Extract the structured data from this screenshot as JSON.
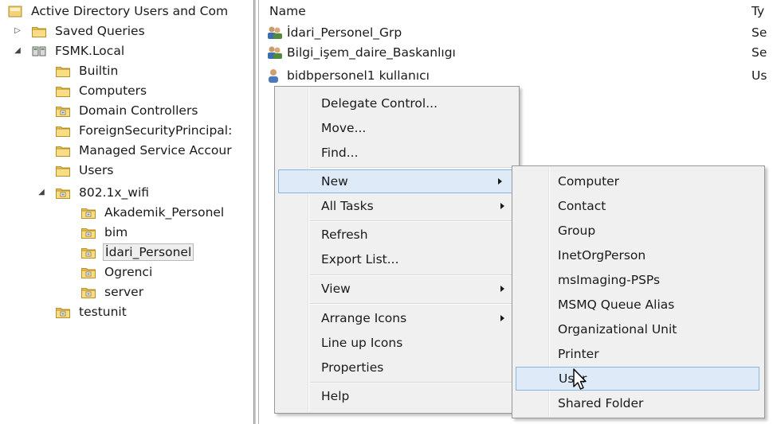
{
  "tree": {
    "root_label": "Active Directory Users and Com",
    "items": [
      {
        "label": "Saved Queries"
      },
      {
        "label": "FSMK.Local"
      },
      {
        "label": "Builtin"
      },
      {
        "label": "Computers"
      },
      {
        "label": "Domain Controllers"
      },
      {
        "label": "ForeignSecurityPrincipal:"
      },
      {
        "label": "Managed Service Accour"
      },
      {
        "label": "Users"
      },
      {
        "label": "802.1x_wifi"
      },
      {
        "label": "Akademik_Personel"
      },
      {
        "label": "bim"
      },
      {
        "label": "İdari_Personel"
      },
      {
        "label": "Ogrenci"
      },
      {
        "label": "server"
      },
      {
        "label": "testunit"
      }
    ]
  },
  "list": {
    "columns": {
      "name": "Name",
      "type": "Ty"
    },
    "rows": [
      {
        "name": "İdari_Personel_Grp",
        "type": "Se",
        "icon": "group-icon"
      },
      {
        "name": "Bilgi_işem_daire_Baskanlıgı",
        "type": "Se",
        "icon": "group-icon"
      },
      {
        "name": "bidbpersonel1 kullanıcı",
        "type": "Us",
        "icon": "user-icon"
      }
    ]
  },
  "context_menu": {
    "items": [
      {
        "label": "Delegate Control..."
      },
      {
        "label": "Move..."
      },
      {
        "label": "Find..."
      },
      {
        "label": "New",
        "submenu": true,
        "highlighted": true
      },
      {
        "label": "All Tasks",
        "submenu": true
      },
      {
        "label": "Refresh"
      },
      {
        "label": "Export List..."
      },
      {
        "label": "View",
        "submenu": true
      },
      {
        "label": "Arrange Icons",
        "submenu": true
      },
      {
        "label": "Line up Icons"
      },
      {
        "label": "Properties"
      },
      {
        "label": "Help"
      }
    ]
  },
  "new_submenu": {
    "items": [
      {
        "label": "Computer"
      },
      {
        "label": "Contact"
      },
      {
        "label": "Group"
      },
      {
        "label": "InetOrgPerson"
      },
      {
        "label": "msImaging-PSPs"
      },
      {
        "label": "MSMQ Queue Alias"
      },
      {
        "label": "Organizational Unit"
      },
      {
        "label": "Printer"
      },
      {
        "label": "User",
        "highlighted": true
      },
      {
        "label": "Shared Folder"
      }
    ]
  },
  "colors": {
    "highlight_bg": "#dfeaf8",
    "highlight_border": "#8ab6e2",
    "folder_yellow": "#f5d77c"
  }
}
